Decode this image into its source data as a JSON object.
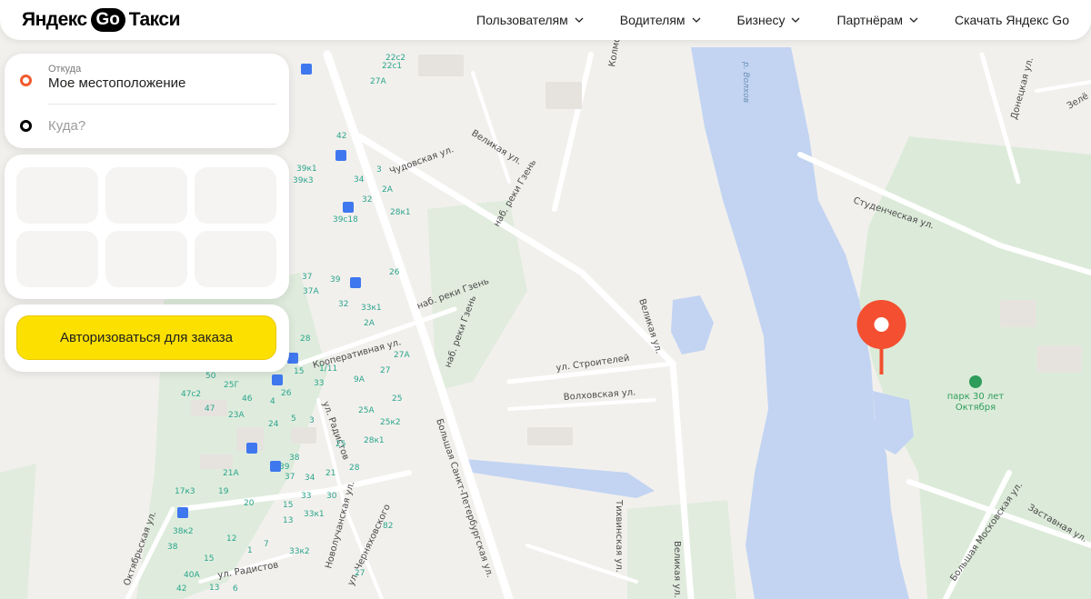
{
  "header": {
    "logo": {
      "brand": "Яндекс",
      "go": "Go",
      "product": "Такси"
    },
    "nav": [
      {
        "label": "Пользователям",
        "has_dropdown": true
      },
      {
        "label": "Водителям",
        "has_dropdown": true
      },
      {
        "label": "Бизнесу",
        "has_dropdown": true
      },
      {
        "label": "Партнёрам",
        "has_dropdown": true
      },
      {
        "label": "Скачать Яндекс Go",
        "has_dropdown": false
      }
    ]
  },
  "route": {
    "from_caption": "Откуда",
    "from_value": "Мое местоположение",
    "to_placeholder": "Куда?"
  },
  "order": {
    "auth_button": "Авторизоваться для заказа"
  },
  "colors": {
    "accent_yellow": "#fce000",
    "from_dot": "#f15a2e",
    "pin": "#f34f30",
    "water": "#c2d4f2",
    "park": "#dcebd9"
  },
  "map": {
    "road_labels": [
      "Великая ул.",
      "Чудовская ул.",
      "наб. реки Гзень",
      "наб. реки Гзень",
      "наб. реки Гзень",
      "Кооперативная ул.",
      "ул. Радистов",
      "Большая Санкт-Петербургская ул.",
      "Великая ул.",
      "ул. Строителей",
      "Волховская ул.",
      "Тихвинская ул.",
      "Великая ул.",
      "Колмовская наб.",
      "Студенческая ул.",
      "Донецкая ул.",
      "Заставная ул.",
      "Большая Московская ул.",
      "ул. Черняховского",
      "Новолучанская ул.",
      "Октябрьская ул.",
      "ул. Радистов",
      "Зелё"
    ],
    "water_label": "р. Волхов",
    "park_label": [
      "парк 30 лет",
      "Октября"
    ],
    "house_numbers": [
      "22с2",
      "22с1",
      "27А",
      "42",
      "39к1",
      "39к3",
      "34",
      "3",
      "2А",
      "32",
      "28к1",
      "39с18",
      "37",
      "39",
      "26",
      "37А",
      "32",
      "33к1",
      "2А",
      "28",
      "1/11",
      "15",
      "27А",
      "50",
      "25Г",
      "26",
      "9А",
      "27",
      "47с2",
      "46",
      "4",
      "33",
      "25",
      "47",
      "23А",
      "5",
      "3",
      "25А",
      "24",
      "25к2",
      "25",
      "28к1",
      "38",
      "21А",
      "39",
      "37",
      "34",
      "21",
      "28",
      "17к3",
      "19",
      "33",
      "30",
      "20",
      "15",
      "33к1",
      "38к2",
      "13",
      "82",
      "12",
      "7",
      "38",
      "1",
      "15",
      "33к2",
      "40А",
      "27",
      "42",
      "13",
      "6"
    ]
  }
}
